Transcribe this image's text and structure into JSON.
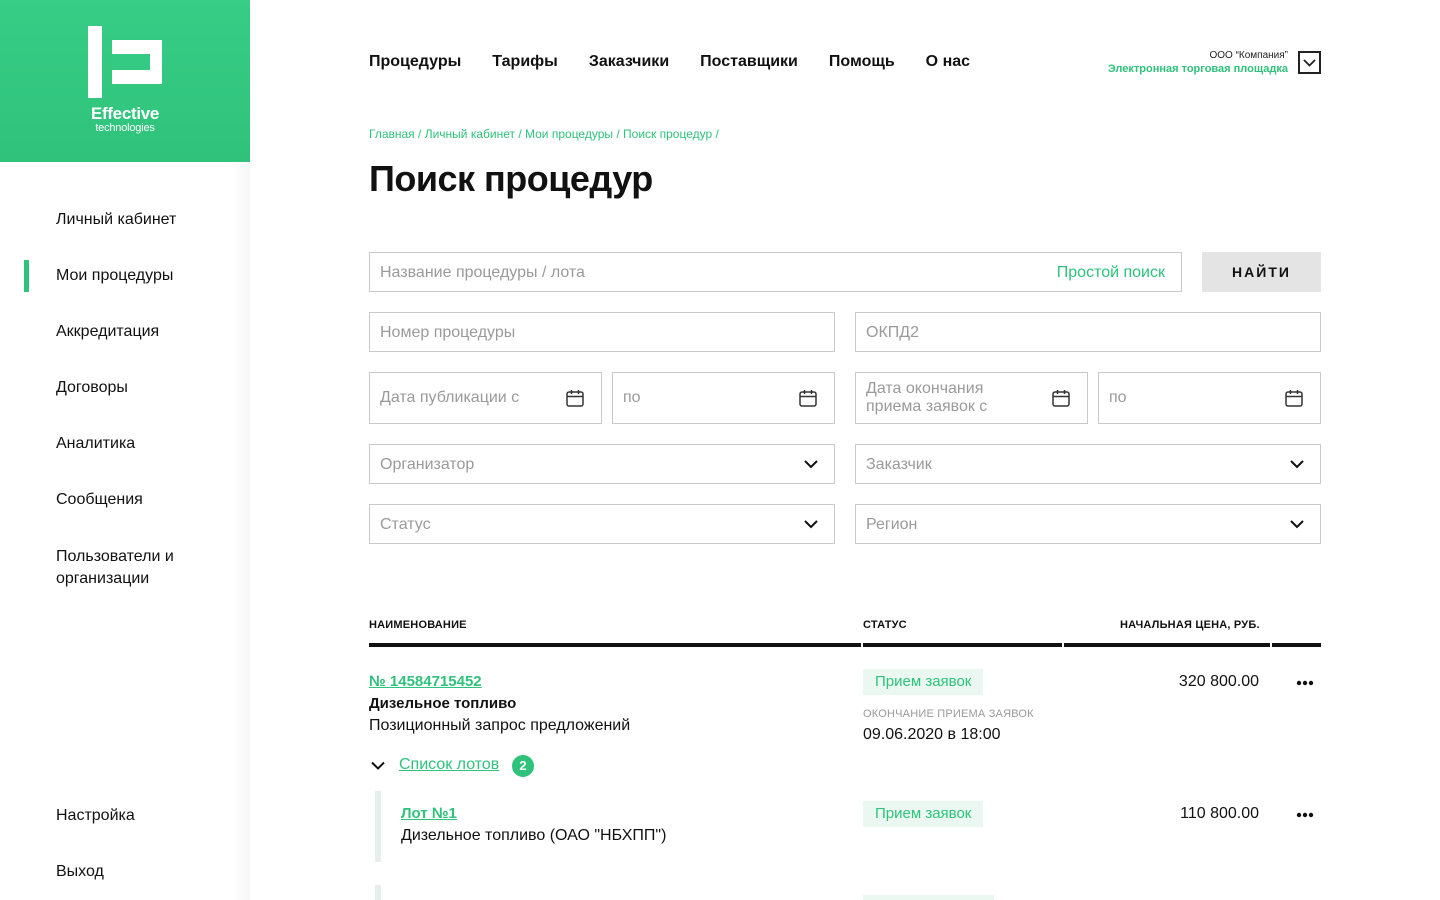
{
  "logo": {
    "line1": "Effective",
    "line2": "technologies"
  },
  "sidebar": {
    "items": [
      {
        "label": "Личный кабинет"
      },
      {
        "label": "Мои процедуры"
      },
      {
        "label": "Аккредитация"
      },
      {
        "label": "Договоры"
      },
      {
        "label": "Аналитика"
      },
      {
        "label": "Сообщения"
      },
      {
        "label": "Пользователи и организации"
      }
    ],
    "settings": "Настройка",
    "logout": "Выход"
  },
  "topnav": [
    "Процедуры",
    "Тарифы",
    "Заказчики",
    "Поставщики",
    "Помощь",
    "О нас"
  ],
  "company": {
    "name": "ООО “Компания”",
    "platform": "Электронная торговая площадка"
  },
  "breadcrumb": [
    "Главная",
    "Личный кабинет",
    "Мои процедуры",
    "Поиск процедур"
  ],
  "page_title": "Поиск процедур",
  "form": {
    "name_placeholder": "Название процедуры / лота",
    "simple_search": "Простой поиск",
    "find_button": "НАЙТИ",
    "number_placeholder": "Номер процедуры",
    "okpd_placeholder": "ОКПД2",
    "pub_from": "Дата публикации с",
    "pub_to": "по",
    "end_from_l1": "Дата окончания",
    "end_from_l2": "приема заявок с",
    "end_to": "по",
    "organizer": "Организатор",
    "customer": "Заказчик",
    "status": "Статус",
    "region": "Регион"
  },
  "table": {
    "headers": {
      "name": "НАИМЕНОВАНИЕ",
      "status": "СТАТУС",
      "price": "НАЧАЛЬНАЯ ЦЕНА, РУБ."
    },
    "row": {
      "number": "№ 14584715452",
      "title": "Дизельное топливо",
      "type": "Позиционный запрос предложений",
      "status": "Прием заявок",
      "deadline_label": "ОКОНЧАНИЕ ПРИЕМА ЗАЯВОК",
      "deadline": "09.06.2020 в 18:00",
      "price": "320 800.00",
      "lots_label": "Список лотов",
      "lots_count": "2"
    },
    "lot": {
      "number": "Лот №1",
      "title": "Дизельное топливо (ОАО \"НБХПП\")",
      "status": "Прием заявок",
      "price": "110 800.00"
    }
  },
  "colors": {
    "accent": "#2fc27b",
    "badge_bg": "#eaf8f1"
  }
}
